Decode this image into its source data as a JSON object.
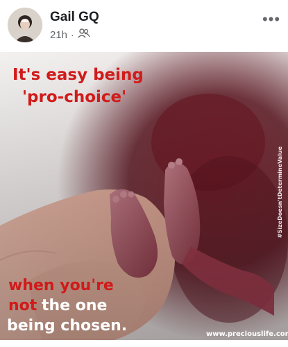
{
  "post": {
    "author": "Gail GQ",
    "time": "21h",
    "audience_icon": "friends-icon",
    "more_icon": "more-options-icon"
  },
  "image": {
    "headline_line1": "It's easy being",
    "headline_line2": "'pro-choice'",
    "bottom_line1": "when you're",
    "bottom_line2_word1": "not",
    "bottom_line2_rest": "the one",
    "bottom_line3": "being chosen.",
    "watermark_url": "www.preciouslife.com",
    "vertical_tag": "#SizeDoesn'tDetermineValue",
    "colors": {
      "headline": "#d11a1a",
      "accent_red": "#c8102e",
      "white": "#ffffff"
    }
  }
}
